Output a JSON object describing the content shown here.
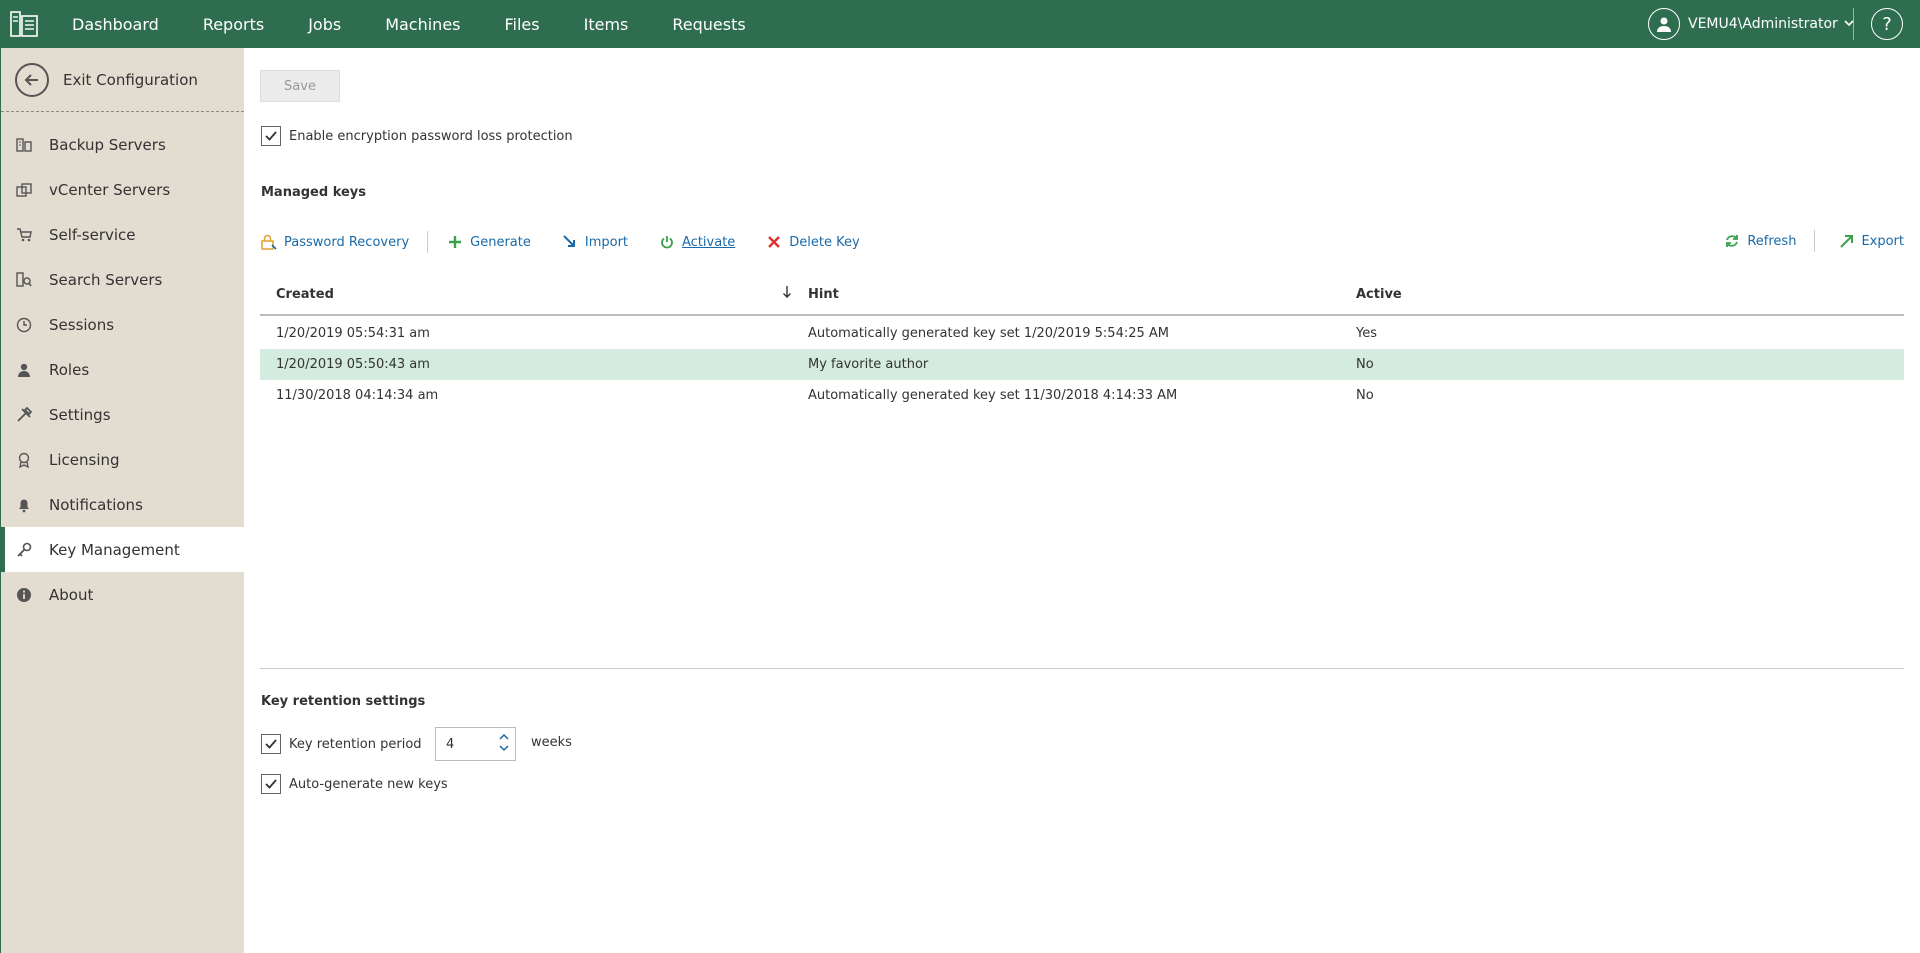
{
  "nav": {
    "items": [
      "Dashboard",
      "Reports",
      "Jobs",
      "Machines",
      "Files",
      "Items",
      "Requests"
    ],
    "user": "VEMU4\\Administrator",
    "help": "?"
  },
  "sidebar": {
    "exit_label": "Exit Configuration",
    "items": [
      {
        "label": "Backup Servers",
        "icon": "server-icon"
      },
      {
        "label": "vCenter Servers",
        "icon": "vcenter-icon"
      },
      {
        "label": "Self-service",
        "icon": "cart-icon"
      },
      {
        "label": "Search Servers",
        "icon": "search-server-icon"
      },
      {
        "label": "Sessions",
        "icon": "clock-icon"
      },
      {
        "label": "Roles",
        "icon": "person-icon"
      },
      {
        "label": "Settings",
        "icon": "tools-icon"
      },
      {
        "label": "Licensing",
        "icon": "license-icon"
      },
      {
        "label": "Notifications",
        "icon": "bell-icon"
      },
      {
        "label": "Key Management",
        "icon": "key-icon",
        "active": true
      },
      {
        "label": "About",
        "icon": "info-icon"
      }
    ]
  },
  "main": {
    "save_label": "Save",
    "encryption_protection_label": "Enable encryption password loss protection",
    "managed_keys_title": "Managed keys",
    "toolbar": {
      "password_recovery": "Password Recovery",
      "generate": "Generate",
      "import": "Import",
      "activate": "Activate",
      "delete_key": "Delete Key",
      "refresh": "Refresh",
      "export": "Export"
    },
    "table": {
      "headers": {
        "created": "Created",
        "hint": "Hint",
        "active": "Active"
      },
      "rows": [
        {
          "created": "1/20/2019 05:54:31 am",
          "hint": "Automatically generated key set 1/20/2019 5:54:25 AM",
          "active": "Yes"
        },
        {
          "created": "1/20/2019 05:50:43 am",
          "hint": "My favorite author",
          "active": "No"
        },
        {
          "created": "11/30/2018 04:14:34 am",
          "hint": "Automatically generated key set 11/30/2018 4:14:33 AM",
          "active": "No"
        }
      ]
    },
    "retention": {
      "title": "Key retention settings",
      "period_label": "Key retention period",
      "period_value": "4",
      "period_unit": "weeks",
      "autogen_label": "Auto-generate new keys"
    }
  },
  "colors": {
    "topbar": "#2e6e4f",
    "sidebar": "#e3ddd1",
    "link": "#1a6aa8",
    "selected_row": "#d4ebe0"
  }
}
